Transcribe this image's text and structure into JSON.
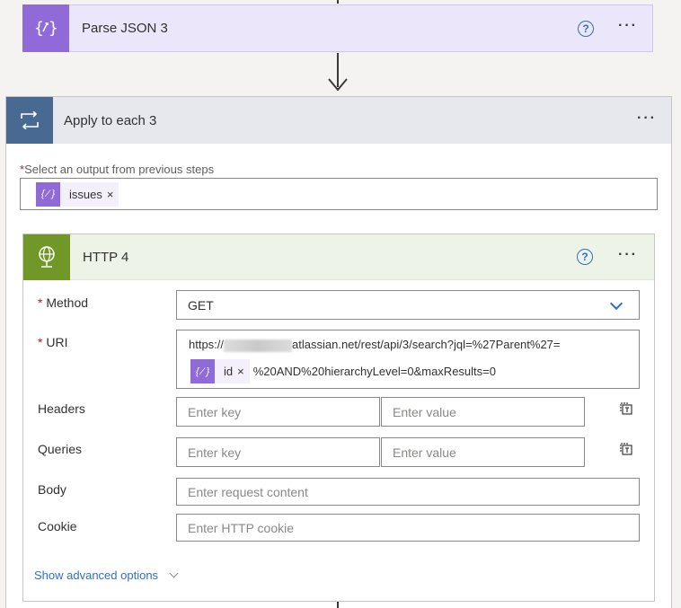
{
  "parse_json": {
    "title": "Parse JSON 3",
    "help": "?",
    "more": "···"
  },
  "apply_each": {
    "title": "Apply to each 3",
    "more": "···",
    "select_label": "Select an output from previous steps",
    "required_mark": "*",
    "token_label": "issues",
    "token_remove": "×"
  },
  "http": {
    "title": "HTTP 4",
    "help": "?",
    "more": "···",
    "method_label": "Method",
    "method_value": "GET",
    "uri_label": "URI",
    "uri_prefix": "https://",
    "uri_after_blur": "atlassian.net/rest/api/3/search?jql=%27Parent%27=",
    "uri_token": "id",
    "uri_token_remove": "×",
    "uri_suffix": "%20AND%20hierarchyLevel=0&maxResults=0",
    "headers_label": "Headers",
    "queries_label": "Queries",
    "key_placeholder": "Enter key",
    "value_placeholder": "Enter value",
    "body_label": "Body",
    "body_placeholder": "Enter request content",
    "cookie_label": "Cookie",
    "cookie_placeholder": "Enter HTTP cookie",
    "advanced_label": "Show advanced options"
  },
  "colors": {
    "parse_accent": "#8f6ad8",
    "apply_accent": "#486991",
    "http_accent": "#709727",
    "link": "#2f6fc4"
  }
}
